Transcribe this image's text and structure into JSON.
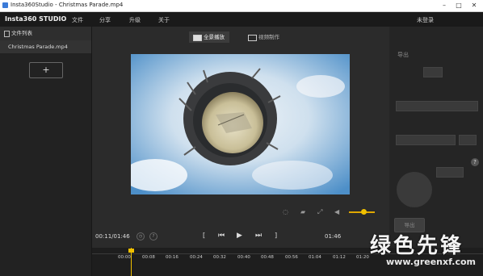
{
  "window": {
    "title": "Insta360Studio - Christmas Parade.mp4"
  },
  "menubar": {
    "logo": "Insta360 STUDIO",
    "items": [
      "文件",
      "分享",
      "升级",
      "关于"
    ],
    "login": "未登录"
  },
  "sidebar": {
    "header": "文件列表",
    "items": [
      {
        "label": "Christmas Parade.mp4"
      }
    ],
    "add_label": "+"
  },
  "tabs": [
    {
      "label": "全景播放",
      "active": true
    },
    {
      "label": "视频制作",
      "active": false
    }
  ],
  "player": {
    "volume_level": 0.55,
    "accent_color": "#f0c000"
  },
  "transport": {
    "current_time": "00:11/01:46",
    "end_time": "01:46"
  },
  "timeline": {
    "ticks": [
      "00:00",
      "00:08",
      "00:16",
      "00:24",
      "00:32",
      "00:40",
      "00:48",
      "00:56",
      "01:04",
      "01:12",
      "01:20"
    ]
  },
  "rightpanel": {
    "title": "导出",
    "export_button": "导出"
  },
  "watermark": {
    "text": "绿色先锋",
    "url": "www.greenxf.com"
  }
}
